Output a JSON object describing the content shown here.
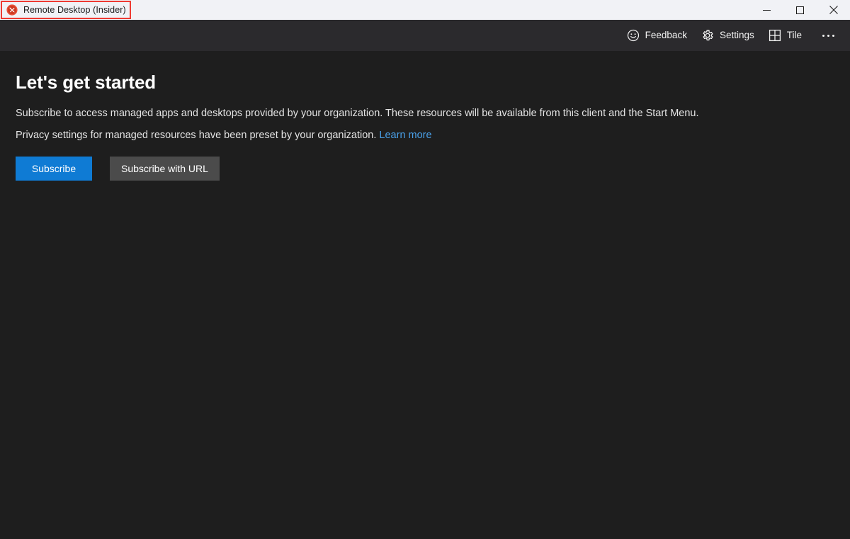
{
  "window": {
    "title": "Remote Desktop (Insider)",
    "app_icon": "remote-desktop-icon",
    "controls": {
      "minimize": "minimize-icon",
      "maximize": "maximize-icon",
      "close": "close-icon"
    },
    "titlebar_bg": "#f1f2f6",
    "commandbar_bg": "#2b2a2d",
    "content_bg": "#1e1e1e"
  },
  "annotation": {
    "color": "#ee3b33",
    "target": "Remote Desktop (Insider)"
  },
  "commandbar": {
    "items": [
      {
        "label": "Feedback",
        "icon": "smiley-face-icon"
      },
      {
        "label": "Settings",
        "icon": "gear-icon"
      },
      {
        "label": "Tile",
        "icon": "tile-grid-icon"
      }
    ],
    "more_icon": "ellipsis-icon"
  },
  "main": {
    "heading": "Let's get started",
    "paragraph1": "Subscribe to access managed apps and desktops provided by your organization. These resources will be available from this client and the Start Menu.",
    "paragraph2_text": "Privacy settings for managed resources have been preset by your organization.",
    "paragraph2_link": "Learn more",
    "buttons": {
      "primary": "Subscribe",
      "secondary": "Subscribe with URL"
    },
    "accent_color": "#0f7bd4",
    "link_color": "#4aa0e8"
  }
}
